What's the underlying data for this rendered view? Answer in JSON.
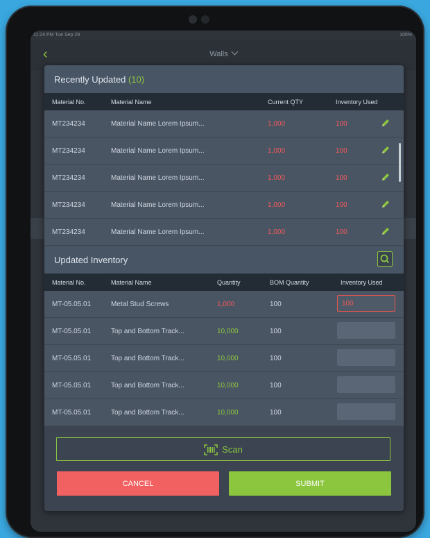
{
  "status_bar": {
    "time": "11:24 PM  Tue Sep 29",
    "battery": "100%"
  },
  "nav": {
    "title": "Walls"
  },
  "recent": {
    "title": "Recently Updated",
    "count": "(10)",
    "headers": [
      "Material No.",
      "Material Name",
      "Current QTY",
      "Inventory Used"
    ],
    "rows": [
      {
        "material_no": "MT234234",
        "name": "Material Name Lorem Ipsum...",
        "current_qty": "1,000",
        "inventory_used": "100"
      },
      {
        "material_no": "MT234234",
        "name": "Material Name Lorem Ipsum...",
        "current_qty": "1,000",
        "inventory_used": "100"
      },
      {
        "material_no": "MT234234",
        "name": "Material Name Lorem Ipsum...",
        "current_qty": "1,000",
        "inventory_used": "100"
      },
      {
        "material_no": "MT234234",
        "name": "Material Name Lorem Ipsum...",
        "current_qty": "1,000",
        "inventory_used": "100"
      },
      {
        "material_no": "MT234234",
        "name": "Material Name Lorem Ipsum...",
        "current_qty": "1,000",
        "inventory_used": "100"
      }
    ]
  },
  "updated": {
    "title": "Updated Inventory",
    "headers": [
      "Material No.",
      "Material Name",
      "Quantity",
      "BOM Quantity",
      "Inventory Used"
    ],
    "rows": [
      {
        "material_no": "MT-05.05.01",
        "name": "Metal Stud Screws",
        "quantity": "1,000",
        "bom": "100",
        "inventory_used": "100"
      },
      {
        "material_no": "MT-05.05.01",
        "name": "Top and Bottom Track...",
        "quantity": "10,000",
        "bom": "100",
        "inventory_used": ""
      },
      {
        "material_no": "MT-05.05.01",
        "name": "Top and Bottom Track...",
        "quantity": "10,000",
        "bom": "100",
        "inventory_used": ""
      },
      {
        "material_no": "MT-05.05.01",
        "name": "Top and Bottom Track...",
        "quantity": "10,000",
        "bom": "100",
        "inventory_used": ""
      },
      {
        "material_no": "MT-05.05.01",
        "name": "Top and Bottom Track...",
        "quantity": "10,000",
        "bom": "100",
        "inventory_used": ""
      }
    ]
  },
  "actions": {
    "scan": "Scan",
    "cancel": "CANCEL",
    "submit": "SUBMIT"
  },
  "colors": {
    "accent_green": "#8cc63f",
    "alert_red": "#f26161",
    "screen_bg": "#3aa7df"
  },
  "icons": {
    "back": "chevron-left-icon",
    "edit": "pencil-icon",
    "search": "search-icon",
    "scan": "barcode-scan-icon",
    "dropdown": "chevron-down-icon"
  }
}
